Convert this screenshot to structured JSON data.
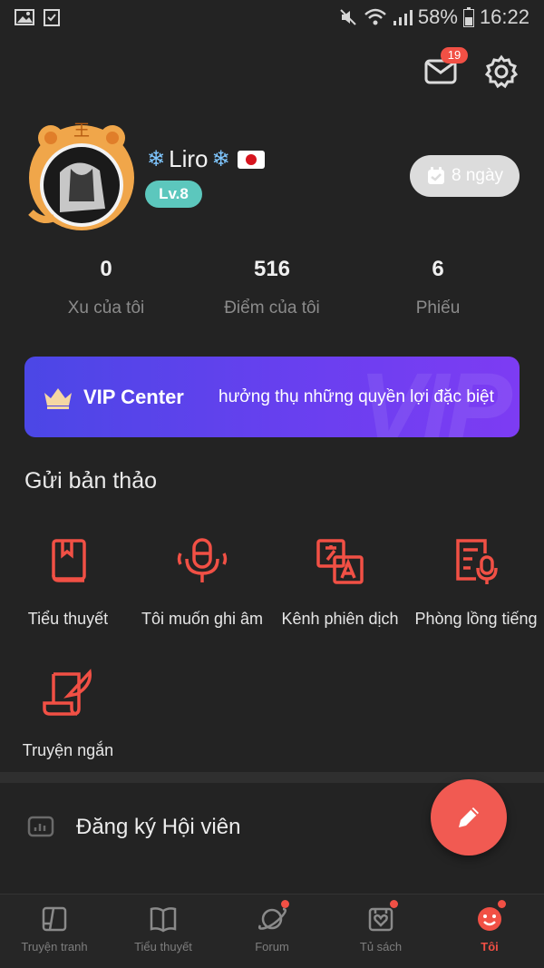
{
  "status_bar": {
    "battery": "58%",
    "time": "16:22"
  },
  "header": {
    "mail_badge": "19"
  },
  "profile": {
    "name": "Liro",
    "level": "Lv.8",
    "streak": "8 ngày"
  },
  "stats": [
    {
      "value": "0",
      "label": "Xu của tôi"
    },
    {
      "value": "516",
      "label": "Điểm của tôi"
    },
    {
      "value": "6",
      "label": "Phiếu"
    }
  ],
  "vip": {
    "title": "VIP Center",
    "subtitle": "hưởng thụ những quyền lợi đặc biệt",
    "watermark": "VIP"
  },
  "submit": {
    "title": "Gửi bản thảo",
    "items": [
      {
        "label": "Tiểu thuyết",
        "icon": "book-icon"
      },
      {
        "label": "Tôi muốn ghi âm",
        "icon": "microphone-icon"
      },
      {
        "label": "Kênh phiên dịch",
        "icon": "translate-icon"
      },
      {
        "label": "Phòng lồng tiếng",
        "icon": "dubbing-icon"
      },
      {
        "label": "Truyện ngắn",
        "icon": "quill-icon"
      }
    ]
  },
  "membership": {
    "label": "Đăng ký Hội viên"
  },
  "bottom_nav": [
    {
      "label": "Truyện tranh",
      "icon": "comic-icon"
    },
    {
      "label": "Tiểu thuyết",
      "icon": "open-book-icon"
    },
    {
      "label": "Forum",
      "icon": "planet-icon"
    },
    {
      "label": "Tủ sách",
      "icon": "bookshelf-icon"
    },
    {
      "label": "Tôi",
      "icon": "smile-icon"
    }
  ],
  "colors": {
    "accent": "#f15045",
    "vip_start": "#4b47e6",
    "vip_end": "#7d3cf3",
    "level": "#5cc7bd",
    "background": "#232323"
  }
}
